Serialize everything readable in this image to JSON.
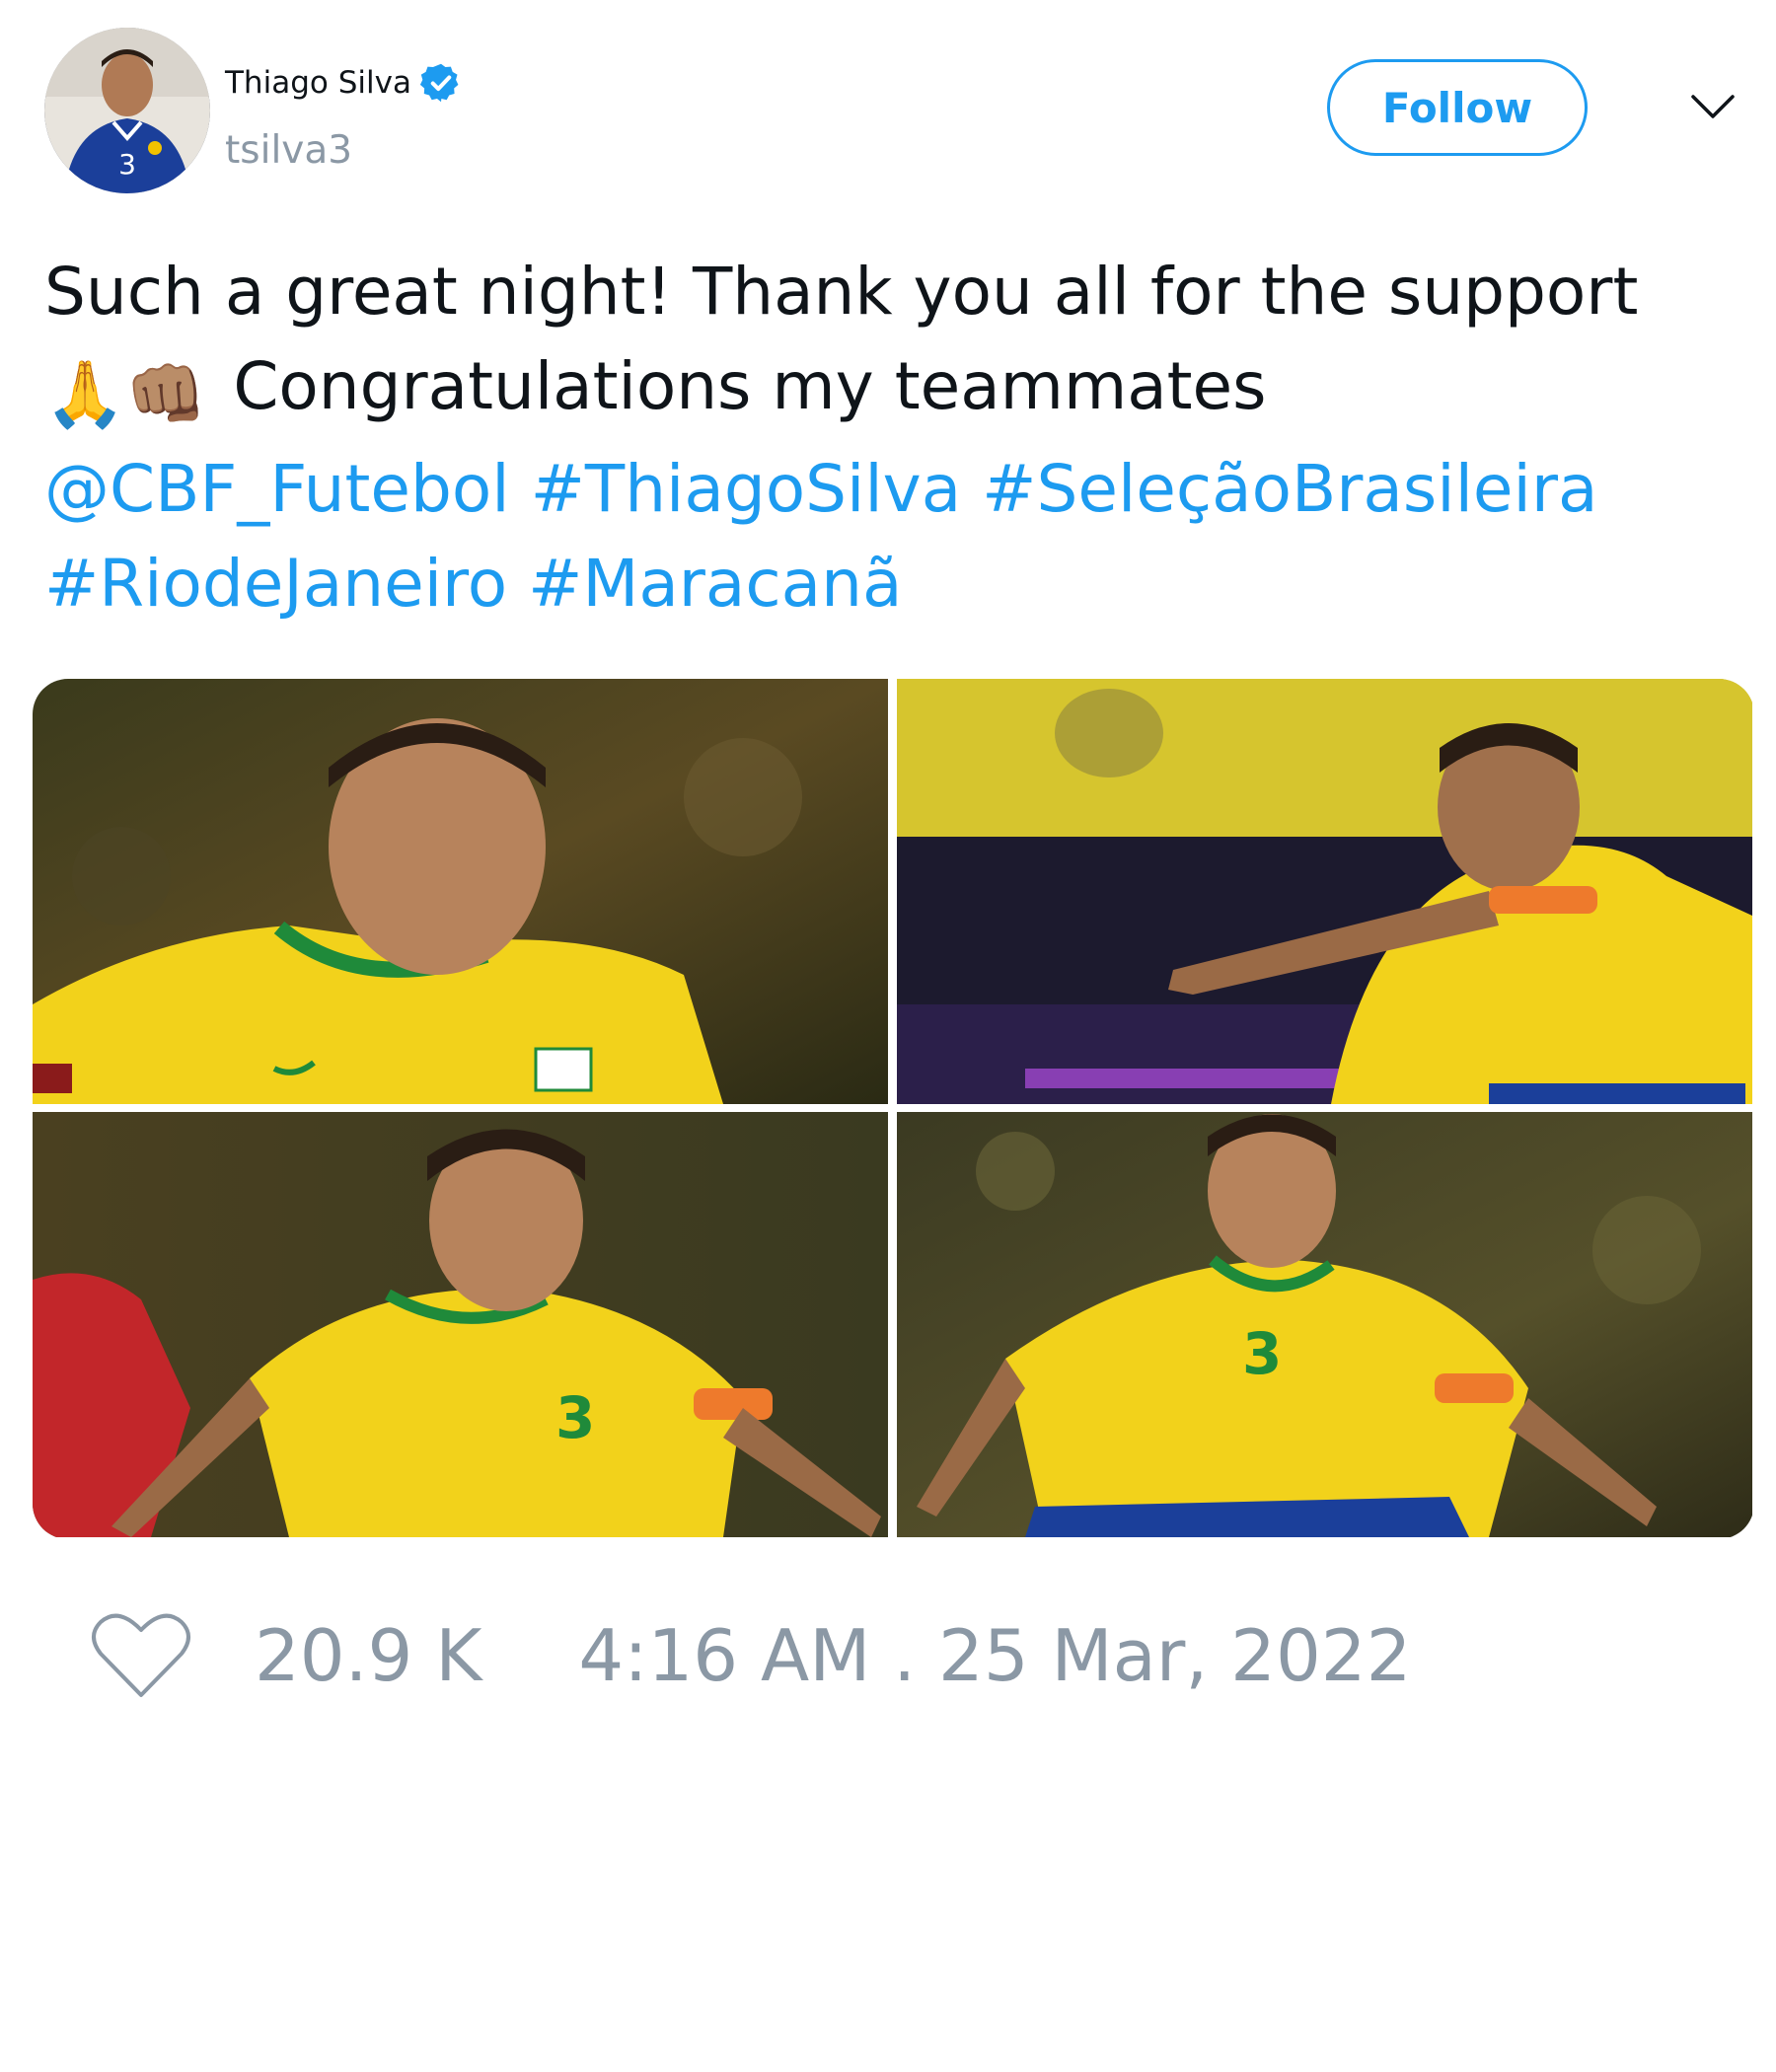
{
  "user": {
    "display_name": "Thiago Silva",
    "handle": "tsilva3",
    "verified": true,
    "avatar_icon": "avatar-photo"
  },
  "header": {
    "follow_label": "Follow",
    "more_icon": "chevron-down-icon"
  },
  "tweet": {
    "line1": "Such a great night! Thank you all for the support",
    "line2_emoji": "🙏👊🏽",
    "line2_text": "Congratulations my teammates",
    "mentions_hashtags_line3": [
      "@CBF_Futebol",
      "#ThiagoSilva",
      "#SeleçãoBrasileira"
    ],
    "mentions_hashtags_line4": [
      "#RiodeJaneiro",
      "#Maracanã"
    ]
  },
  "media": {
    "photos": [
      {
        "name": "photo-1"
      },
      {
        "name": "photo-2"
      },
      {
        "name": "photo-3"
      },
      {
        "name": "photo-4"
      }
    ]
  },
  "footer": {
    "likes": "20.9 K",
    "timestamp": "4:16 AM . 25 Mar, 2022"
  },
  "colors": {
    "accent": "#1d9bf0",
    "muted": "#8b98a5",
    "text": "#0f1419",
    "jersey_yellow": "#f2d21b",
    "jersey_green": "#1f8a3a"
  }
}
